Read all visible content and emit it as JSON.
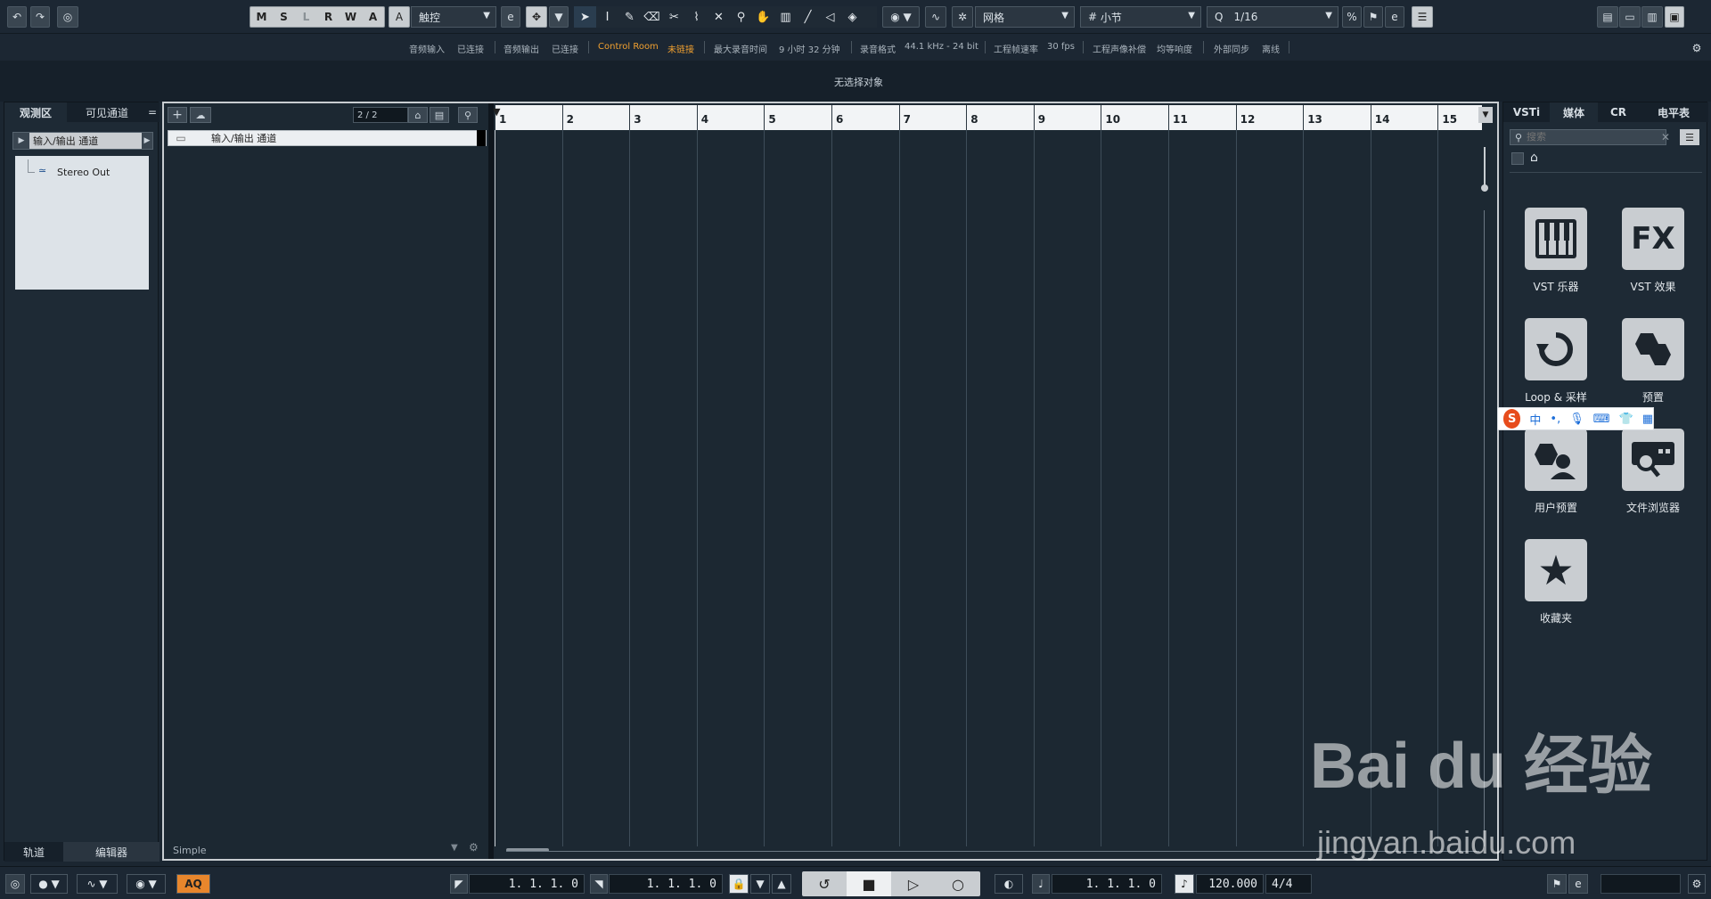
{
  "toolbar": {
    "msl": [
      "M",
      "S",
      "L",
      "R",
      "W",
      "A"
    ],
    "automation_mode": "触控",
    "snap_type": "网格",
    "grid_type": "小节",
    "quantize": "1/16",
    "q_label": "Q"
  },
  "status": {
    "audio_in_label": "音频输入",
    "audio_in_value": "已连接",
    "audio_out_label": "音频输出",
    "audio_out_value": "已连接",
    "control_room_label": "Control Room",
    "control_room_value": "未链接",
    "max_rec_label": "最大录音时间",
    "max_rec_value": "9 小时 32 分钟",
    "rec_format_label": "录音格式",
    "rec_format_value": "44.1 kHz - 24 bit",
    "frame_rate_label": "工程帧速率",
    "frame_rate_value": "30 fps",
    "pan_law_label": "工程声像补偿",
    "loudness_label": "均等响度",
    "ext_sync_label": "外部同步",
    "ext_sync_value": "离线"
  },
  "info_line": "无选择对象",
  "inspector": {
    "tabs": [
      "观测区",
      "可见通道"
    ],
    "folder_label": "输入/输出 通道",
    "tree_item": "Stereo Out",
    "bottom_tabs": [
      "轨道",
      "编辑器"
    ]
  },
  "tracklist": {
    "counter": "2 / 2",
    "track_name": "输入/输出 通道",
    "preset": "Simple"
  },
  "ruler_bars": [
    "1",
    "2",
    "3",
    "4",
    "5",
    "6",
    "7",
    "8",
    "9",
    "10",
    "11",
    "12",
    "13",
    "14",
    "15"
  ],
  "rightzone": {
    "tabs": [
      "VSTi",
      "媒体",
      "CR",
      "电平表"
    ],
    "search_placeholder": "搜索",
    "items": [
      "VST 乐器",
      "VST 效果",
      "Loop & 采样",
      "预置",
      "用户预置",
      "文件浏览器",
      "收藏夹"
    ],
    "fx_glyph": "FX",
    "ime_label": "中"
  },
  "transport": {
    "aq": "AQ",
    "left_locator": "1. 1. 1.   0",
    "right_locator": "1. 1. 1.   0",
    "position": "1. 1. 1.   0",
    "tempo": "120.000",
    "signature": "4/4"
  },
  "watermark": {
    "brand": "Bai du 经验",
    "url": "jingyan.baidu.com"
  }
}
